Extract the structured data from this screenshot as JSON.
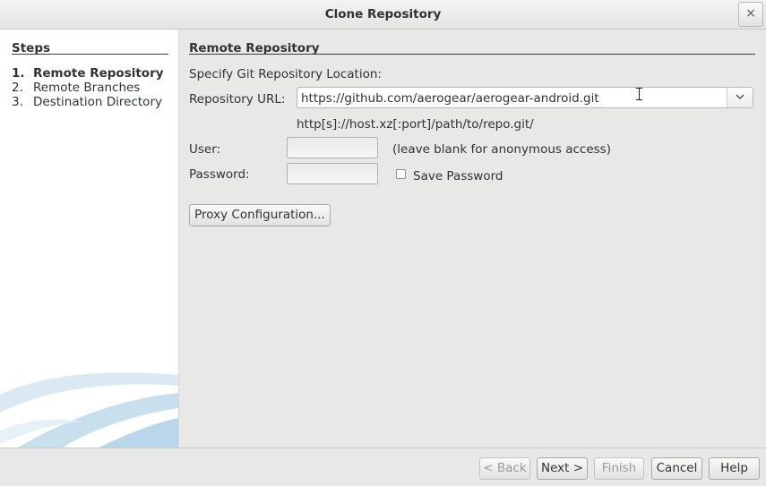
{
  "window": {
    "title": "Clone Repository",
    "close_glyph": "×"
  },
  "steps": {
    "title": "Steps",
    "items": [
      {
        "num": "1.",
        "label": "Remote Repository",
        "active": true
      },
      {
        "num": "2.",
        "label": "Remote Branches",
        "active": false
      },
      {
        "num": "3.",
        "label": "Destination Directory",
        "active": false
      }
    ]
  },
  "panel": {
    "title": "Remote Repository",
    "specify_label": "Specify Git Repository Location:",
    "repo_url_label": "Repository URL:",
    "repo_url_value": "https://github.com/aerogear/aerogear-android.git",
    "url_hint": "http[s]://host.xz[:port]/path/to/repo.git/",
    "user_label": "User:",
    "user_value": "",
    "user_hint": "(leave blank for anonymous access)",
    "password_label": "Password:",
    "password_value": "",
    "save_password_label": "Save Password",
    "save_password_checked": false,
    "proxy_button": "Proxy Configuration..."
  },
  "footer": {
    "back": "< Back",
    "next": "Next >",
    "finish": "Finish",
    "cancel": "Cancel",
    "help": "Help"
  },
  "icons": {
    "close": "close-icon",
    "dropdown": "chevron-down-icon",
    "cursor": "text-cursor-icon",
    "checkbox": "checkbox-icon"
  }
}
